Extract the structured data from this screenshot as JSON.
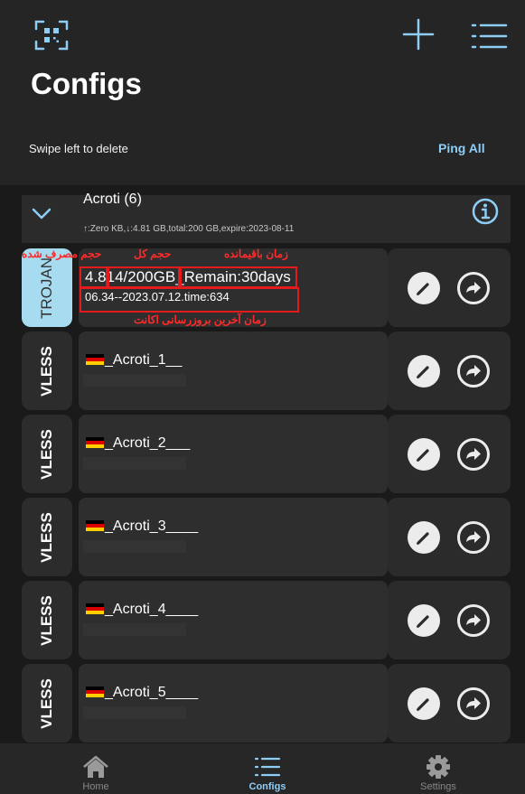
{
  "header": {
    "title": "Configs",
    "swipe_hint": "Swipe left to delete",
    "ping_all": "Ping All",
    "icons": [
      "qr-code-icon",
      "plus-icon",
      "list-menu-icon"
    ]
  },
  "group": {
    "name": "Acroti (6)",
    "stats": "↑:Zero KB,↓:4.81 GB,total:200 GB,expire:2023-08-11"
  },
  "configs": [
    {
      "protocol": "TROJAN",
      "usage": "4.814/200GB_Remain:30days",
      "updated": "06.34--2023.07.12.time:634"
    },
    {
      "protocol": "VLESS",
      "name": "_Acroti_1__"
    },
    {
      "protocol": "VLESS",
      "name": "_Acroti_2___"
    },
    {
      "protocol": "VLESS",
      "name": "_Acroti_3____"
    },
    {
      "protocol": "VLESS",
      "name": "_Acroti_4____"
    },
    {
      "protocol": "VLESS",
      "name": "_Acroti_5____"
    }
  ],
  "annotations": {
    "used": "حجم مصرف شده",
    "total": "حجم کل",
    "remaining": "زمان باقیمانده",
    "last_update": "زمان آخرین بروزرسانی اکانت"
  },
  "tabs": [
    {
      "label": "Home",
      "icon": "home-icon"
    },
    {
      "label": "Configs",
      "icon": "list-icon",
      "active": true
    },
    {
      "label": "Settings",
      "icon": "gear-icon"
    }
  ],
  "colors": {
    "accent": "#8ecdf6",
    "header_bg": "#252525",
    "page_bg": "#1a1a1a",
    "trojan_badge": "#a7dbef",
    "annotation_red": "#e31b1b"
  }
}
